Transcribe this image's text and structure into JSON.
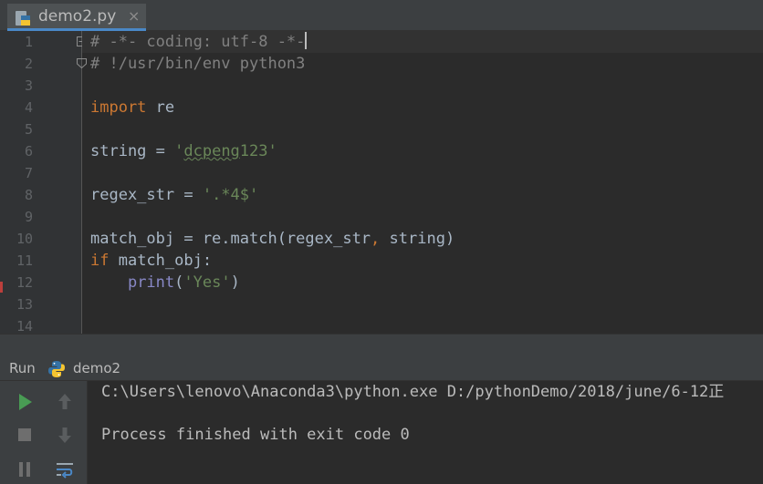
{
  "editor_tab": {
    "filename": "demo2.py",
    "close": "×"
  },
  "editor": {
    "line_numbers": [
      "1",
      "2",
      "3",
      "4",
      "5",
      "6",
      "7",
      "8",
      "9",
      "10",
      "11",
      "12",
      "13",
      "14"
    ],
    "line1": {
      "comment": "# -*- coding: utf-8 -*-"
    },
    "line2": {
      "comment": "# !/usr/bin/env python3"
    },
    "line4": {
      "kw": "import",
      "rest": " re"
    },
    "line6": {
      "lhs": "string = ",
      "q1": "'",
      "squiggle": "dcpeng",
      "tail": "123'"
    },
    "line8": {
      "lhs": "regex_str = ",
      "str": "'.*4$'"
    },
    "line10": {
      "a": "match_obj = re.match(regex_str",
      "comma": ",",
      "b": " string)"
    },
    "line11": {
      "kw": "if",
      "rest": " match_obj:"
    },
    "line12": {
      "indent": "    ",
      "fn": "print",
      "open": "(",
      "str": "'Yes'",
      "close": ")"
    }
  },
  "run_panel": {
    "label": "Run",
    "config_name": "demo2"
  },
  "console": {
    "lines": [
      "C:\\Users\\lenovo\\Anaconda3\\python.exe D:/pythonDemo/2018/june/6-12正",
      "",
      "Process finished with exit code 0"
    ]
  },
  "colors": {
    "keyword": "#cc7832",
    "string": "#6a8759",
    "comment": "#808080",
    "builtin": "#8888c6",
    "run_green": "#499c54"
  }
}
